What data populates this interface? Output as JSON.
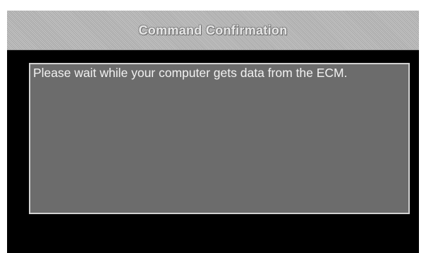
{
  "dialog": {
    "title": "Command Confirmation",
    "message": "Please wait while your computer gets data from the ECM."
  },
  "colors": {
    "dialog_background": "#000000",
    "titlebar_background": "#b9b9b9",
    "message_box_background": "#6c6c6c",
    "message_box_border": "#d2d2d2",
    "text": "#f2f2f2"
  }
}
